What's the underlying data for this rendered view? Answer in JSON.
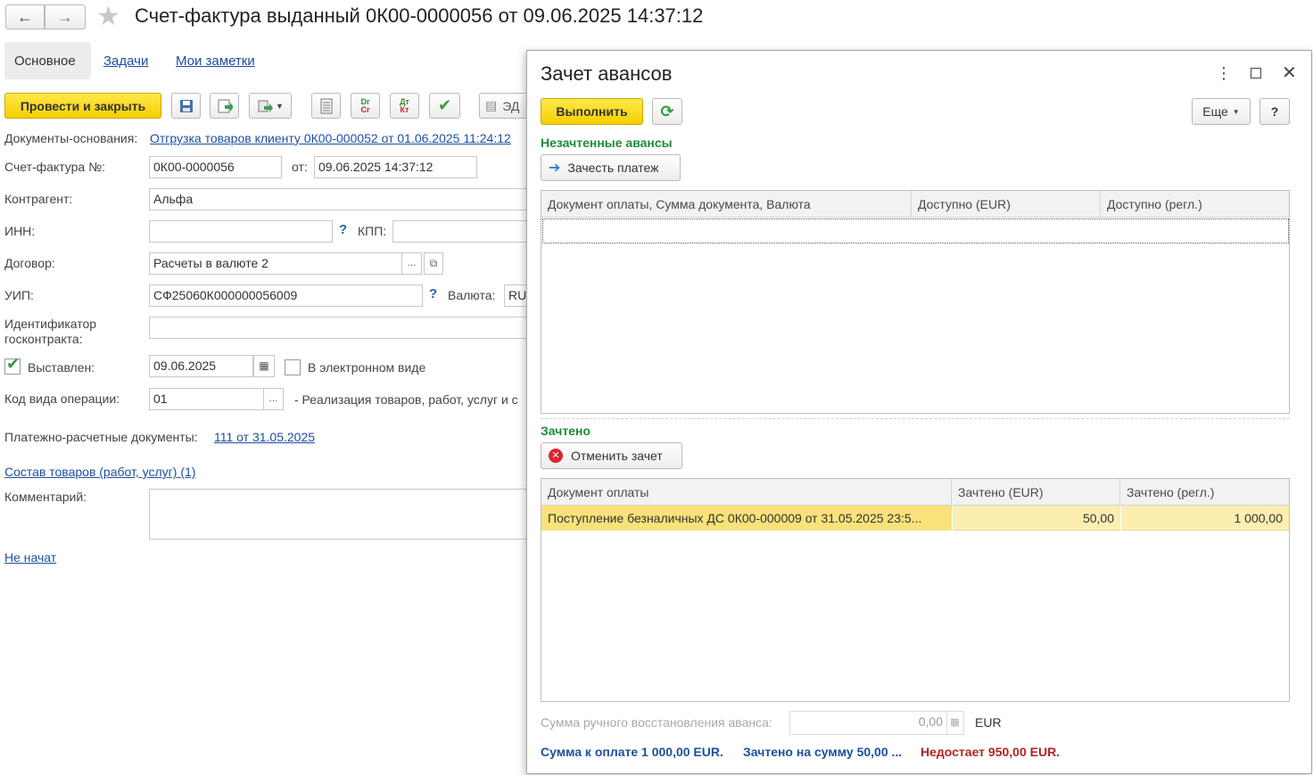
{
  "window": {
    "title": "Счет-фактура выданный 0К00-0000056 от 09.06.2025 14:37:12"
  },
  "tabs": [
    "Основное",
    "Задачи",
    "Мои заметки"
  ],
  "toolbar": {
    "post_close": "Провести и закрыть",
    "edo": "ЭД"
  },
  "form": {
    "basis_label": "Документы-основания:",
    "basis_link": "Отгрузка товаров клиенту 0К00-000052 от 01.06.2025 11:24:12",
    "invoice_label": "Счет-фактура №:",
    "invoice_number": "0К00-0000056",
    "from_label": "от:",
    "invoice_date": "09.06.2025 14:37:12",
    "counterparty_label": "Контрагент:",
    "counterparty": "Альфа",
    "inn_label": "ИНН:",
    "inn": "",
    "kpp_label": "КПП:",
    "kpp": "",
    "contract_label": "Договор:",
    "contract": "Расчеты в валюте 2",
    "uip_label": "УИП:",
    "uip": "СФ25060К000000056009",
    "currency_label": "Валюта:",
    "currency": "RU",
    "gov_id_label_1": "Идентификатор",
    "gov_id_label_2": "госконтракта:",
    "issued_label": "Выставлен:",
    "issued_date": "09.06.2025",
    "electronic_label": "В электронном виде",
    "op_code_label": "Код вида операции:",
    "op_code": "01",
    "op_code_desc": "- Реализация товаров, работ, услуг и с",
    "payment_docs_label": "Платежно-расчетные документы:",
    "payment_docs_link": "111 от 31.05.2025",
    "goods_link": "Состав товаров (работ, услуг) (1)",
    "comment_label": "Комментарий:",
    "comment": "",
    "status_link": "Не начат"
  },
  "dialog": {
    "title": "Зачет авансов",
    "execute": "Выполнить",
    "more": "Еще",
    "help": "?",
    "unapplied_title": "Незачтенные авансы",
    "apply_payment": "Зачесть платеж",
    "unapplied_columns": [
      "Документ оплаты, Сумма документа, Валюта",
      "Доступно (EUR)",
      "Доступно (регл.)"
    ],
    "applied_title": "Зачтено",
    "cancel_apply": "Отменить зачет",
    "applied_columns": [
      "Документ оплаты",
      "Зачтено (EUR)",
      "Зачтено (регл.)"
    ],
    "applied_rows": [
      {
        "doc": "Поступление безналичных ДС 0К00-000009 от 31.05.2025 23:5...",
        "eur": "50,00",
        "reg": "1 000,00"
      }
    ],
    "manual_label": "Сумма ручного восстановления аванса:",
    "manual_value": "0,00",
    "manual_currency": "EUR",
    "summary_total": "Сумма к оплате 1 000,00 EUR.",
    "summary_applied": "Зачтено на сумму 50,00 ...",
    "summary_missing": "Недостает 950,00 EUR."
  },
  "colors": {
    "yellow_button": "#f5cf00",
    "section_green": "#1e8a3a",
    "link_blue": "#1c4fa0",
    "selected_row": "#fbeeb0",
    "missing_red": "#b22222"
  }
}
